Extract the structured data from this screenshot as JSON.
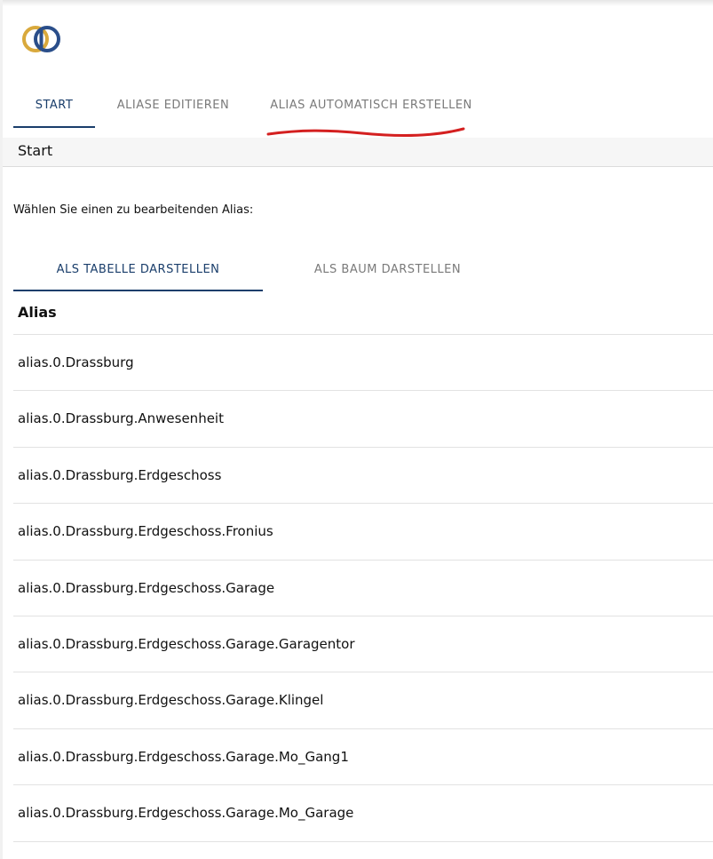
{
  "main_tabs": [
    {
      "label": "START",
      "active": true
    },
    {
      "label": "ALIASE EDITIEREN",
      "active": false
    },
    {
      "label": "ALIAS AUTOMATISCH ERSTELLEN",
      "active": false
    }
  ],
  "section": {
    "title": "Start"
  },
  "instruction": "Wählen Sie einen zu bearbeitenden Alias:",
  "view_tabs": [
    {
      "label": "ALS TABELLE DARSTELLEN",
      "active": true
    },
    {
      "label": "ALS BAUM DARSTELLEN",
      "active": false
    }
  ],
  "table": {
    "header": "Alias",
    "rows": [
      "alias.0.Drassburg",
      "alias.0.Drassburg.Anwesenheit",
      "alias.0.Drassburg.Erdgeschoss",
      "alias.0.Drassburg.Erdgeschoss.Fronius",
      "alias.0.Drassburg.Erdgeschoss.Garage",
      "alias.0.Drassburg.Erdgeschoss.Garage.Garagentor",
      "alias.0.Drassburg.Erdgeschoss.Garage.Klingel",
      "alias.0.Drassburg.Erdgeschoss.Garage.Mo_Gang1",
      "alias.0.Drassburg.Erdgeschoss.Garage.Mo_Garage"
    ]
  },
  "colors": {
    "accent": "#1a3e6b",
    "tab_inactive": "#7a7a7a",
    "annotation": "#d42020",
    "logo_gold": "#d9a93c",
    "logo_blue": "#2a4e8a"
  },
  "icons": {
    "logo": "iobroker-logo"
  }
}
